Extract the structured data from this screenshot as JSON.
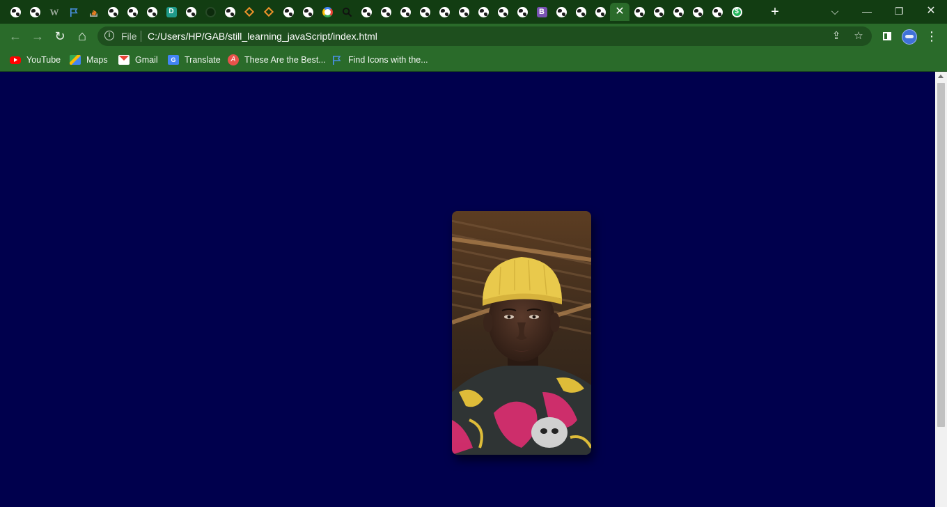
{
  "browser": {
    "tabs": [
      {
        "icon": "globe-icon"
      },
      {
        "icon": "globe-icon"
      },
      {
        "icon": "w-icon",
        "glyph": "W"
      },
      {
        "icon": "flag-icon"
      },
      {
        "icon": "stack-overflow-icon"
      },
      {
        "icon": "globe-icon"
      },
      {
        "icon": "globe-icon"
      },
      {
        "icon": "globe-icon"
      },
      {
        "icon": "d-icon",
        "glyph": "D"
      },
      {
        "icon": "globe-icon"
      },
      {
        "icon": "github-icon"
      },
      {
        "icon": "globe-icon"
      },
      {
        "icon": "diamond-icon"
      },
      {
        "icon": "diamond-icon"
      },
      {
        "icon": "globe-icon"
      },
      {
        "icon": "globe-icon"
      },
      {
        "icon": "google-icon"
      },
      {
        "icon": "magnifier-icon"
      },
      {
        "icon": "globe-icon"
      },
      {
        "icon": "globe-icon"
      },
      {
        "icon": "globe-icon"
      },
      {
        "icon": "globe-icon"
      },
      {
        "icon": "globe-icon"
      },
      {
        "icon": "globe-icon"
      },
      {
        "icon": "globe-icon"
      },
      {
        "icon": "globe-icon"
      },
      {
        "icon": "globe-icon"
      },
      {
        "icon": "bootstrap-icon",
        "glyph": "B"
      },
      {
        "icon": "globe-icon"
      },
      {
        "icon": "globe-icon"
      },
      {
        "icon": "globe-icon"
      },
      {
        "icon": "close-icon",
        "active": true,
        "glyph": "✕"
      },
      {
        "icon": "globe-icon"
      },
      {
        "icon": "globe-icon"
      },
      {
        "icon": "globe-icon"
      },
      {
        "icon": "globe-icon"
      },
      {
        "icon": "globe-icon"
      },
      {
        "icon": "dollar-icon",
        "glyph": "$"
      }
    ],
    "new_tab_glyph": "+",
    "window_controls": {
      "tab_search": "⌵",
      "minimize": "—",
      "restore": "❐",
      "close": "✕"
    },
    "nav": {
      "back": "←",
      "forward": "→",
      "reload": "↻",
      "home": "⌂"
    },
    "address": {
      "scheme_label": "File",
      "url": "C:/Users/HP/GAB/still_learning_javaScript/index.html",
      "info_glyph": "i"
    },
    "toolbar_icons": {
      "share": "⇪",
      "star": "☆",
      "menu": "⋮"
    }
  },
  "bookmarks": [
    {
      "label": "YouTube",
      "icon": "youtube-icon"
    },
    {
      "label": "Maps",
      "icon": "maps-icon"
    },
    {
      "label": "Gmail",
      "icon": "gmail-icon"
    },
    {
      "label": "Translate",
      "icon": "translate-icon",
      "glyph": "G"
    },
    {
      "label": "These Are the Best...",
      "icon": "these-are-the-best-icon",
      "glyph": "A"
    },
    {
      "label": "Find Icons with the...",
      "icon": "flag-icon"
    }
  ],
  "page": {
    "background": "#00004d",
    "photo": {
      "subject": "portrait-photo"
    }
  },
  "colors": {
    "tabstrip": "#123d12",
    "toolbar": "#2a6b2a",
    "omnibox": "#1e4f1e"
  }
}
